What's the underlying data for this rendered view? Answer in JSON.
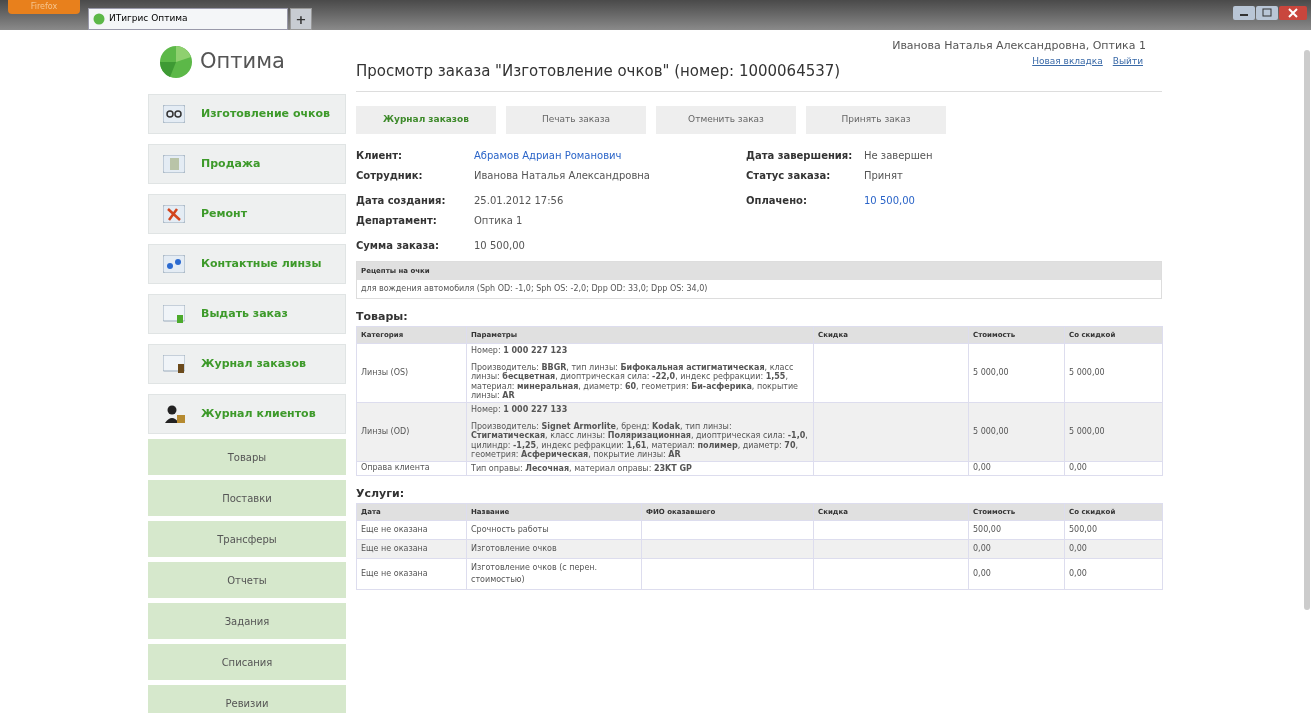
{
  "browser": {
    "menu_button": "Firefox",
    "tab_title": "ИТигрис Оптима",
    "new_tab": "+"
  },
  "logo": "Оптима",
  "user": {
    "name": "Иванова Наталья Александровна, Оптика 1",
    "links": [
      "Новая вкладка",
      "Выйти"
    ]
  },
  "sidebar": {
    "main_items": [
      {
        "label": "Изготовление очков",
        "kind": "glasses"
      },
      {
        "label": "Продажа",
        "kind": "money"
      },
      {
        "label": "Ремонт",
        "kind": "tools"
      },
      {
        "label": "Контактные линзы",
        "kind": "lenses"
      },
      {
        "label": "Выдать заказ",
        "kind": "issue"
      },
      {
        "label": "Журнал заказов",
        "kind": "journal"
      },
      {
        "label": "Журнал клиентов",
        "kind": "clients"
      }
    ],
    "sub_items": [
      "Товары",
      "Поставки",
      "Трансферы",
      "Отчеты",
      "Задания",
      "Списания",
      "Ревизии"
    ]
  },
  "page_title": "Просмотр заказа \"Изготовление очков\" (номер: 1000064537)",
  "actions": [
    {
      "label": "Журнал заказов",
      "selected": true
    },
    {
      "label": "Печать заказа",
      "selected": false
    },
    {
      "label": "Отменить заказ",
      "selected": false
    },
    {
      "label": "Принять заказ",
      "selected": false
    }
  ],
  "fields_left": [
    [
      {
        "label": "Клиент:",
        "value": "Абрамов Адриан Романович",
        "link": true
      },
      {
        "label": "Сотрудник:",
        "value": "Иванова Наталья Александровна",
        "link": false
      }
    ],
    [
      {
        "label": "Дата создания:",
        "value": "25.01.2012 17:56",
        "link": false
      },
      {
        "label": "Департамент:",
        "value": "Оптика 1",
        "link": false
      }
    ],
    [
      {
        "label": "Сумма заказа:",
        "value": "10 500,00",
        "link": false
      }
    ]
  ],
  "fields_right": [
    [
      {
        "label": "Дата завершения:",
        "value": "Не завершен",
        "link": false
      },
      {
        "label": "Статус заказа:",
        "value": "Принят",
        "link": false
      }
    ],
    [
      {
        "label": "Оплачено:",
        "value": "10 500,00",
        "link": true
      }
    ]
  ],
  "prescriptions": {
    "title": "Рецепты на очки",
    "text": "для вождения автомобиля (Sph OD: -1,0; Sph OS: -2,0; Dpp OD: 33,0; Dpp OS: 34,0)"
  },
  "goods": {
    "title": "Товары:",
    "columns": [
      "Категория",
      "Параметры",
      "Скидка",
      "Стоимость",
      "Со скидкой"
    ],
    "rows": [
      {
        "category": "Линзы (OS)",
        "number": "Номер: **1 000 227 123**",
        "params": "Производитель: **BBGR**, тип линзы: **Бифокальная астигматическая**, класс линзы: **бесцветная**, диоптрическая сила: **-22,0**, индекс рефракции: **1,55**, материал: **минеральная**, диаметр: **60**, геометрия: **Би-асферика**, покрытие линзы: **AR**",
        "discount": "",
        "price": "5 000,00",
        "discounted": "5 000,00"
      },
      {
        "category": "Линзы (OD)",
        "number": "Номер: **1 000 227 133**",
        "params": "Производитель: **Signet Armorlite**, бренд: **Kodak**, тип линзы: **Стигматическая**, класс линзы: **Поляризационная**, диоптрическая сила: **-1,0**, цилиндр: **-1,25**, индекс рефракции: **1,61**, материал: **полимер**, диаметр: **70**, геометрия: **Асферическая**, покрытие линзы: **AR**",
        "discount": "",
        "price": "5 000,00",
        "discounted": "5 000,00"
      },
      {
        "category": "Оправа клиента",
        "params": "Тип оправы: **Лесочная**, материал оправы: **23KT GP**",
        "discount": "",
        "price": "0,00",
        "discounted": "0,00"
      }
    ]
  },
  "services": {
    "title": "Услуги:",
    "columns": [
      "Дата",
      "Название",
      "ФИО оказавшего",
      "Скидка",
      "Стоимость",
      "Со скидкой"
    ],
    "rows": [
      [
        "Еще не оказана",
        "Срочность работы",
        "",
        "",
        "500,00",
        "500,00"
      ],
      [
        "Еще не оказана",
        "Изготовление очков",
        "",
        "",
        "0,00",
        "0,00"
      ],
      [
        "Еще не оказана",
        "Изготовление очков (с перен. стоимостью)",
        "",
        "",
        "0,00",
        "0,00"
      ]
    ]
  }
}
